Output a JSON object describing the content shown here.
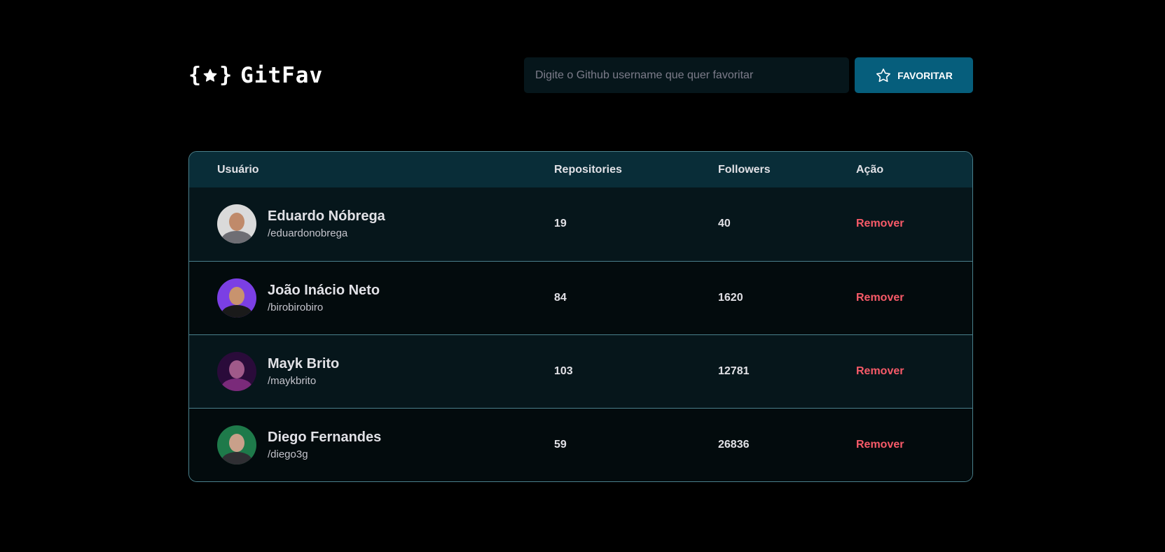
{
  "app": {
    "title": "GitFav",
    "logo_icon": "braces-star-icon"
  },
  "search": {
    "placeholder": "Digite o Github username que quer favoritar",
    "value": "",
    "button_label": "Favoritar",
    "button_icon": "star-outline-icon"
  },
  "colors": {
    "background": "#000000",
    "header_row": "#092D38",
    "row_odd": "#06161B",
    "row_even": "#030B0D",
    "border": "#4A808C",
    "button": "#065E7C",
    "remove": "#F75A68"
  },
  "table": {
    "headers": {
      "user": "Usuário",
      "repositories": "Repositories",
      "followers": "Followers",
      "action": "Ação"
    },
    "rows": [
      {
        "name": "Eduardo Nóbrega",
        "login": "/eduardonobrega",
        "repositories": "19",
        "followers": "40",
        "action": "Remover",
        "avatar_colors": [
          "#DADADA",
          "#C08A6A",
          "#6E6E74"
        ]
      },
      {
        "name": "João Inácio Neto",
        "login": "/birobirobiro",
        "repositories": "84",
        "followers": "1620",
        "action": "Remover",
        "avatar_colors": [
          "#7B3FE4",
          "#C8936E",
          "#1A1A1A"
        ]
      },
      {
        "name": "Mayk Brito",
        "login": "/maykbrito",
        "repositories": "103",
        "followers": "12781",
        "action": "Remover",
        "avatar_colors": [
          "#2A0B3A",
          "#A05A8A",
          "#7A2A7A"
        ]
      },
      {
        "name": "Diego Fernandes",
        "login": "/diego3g",
        "repositories": "59",
        "followers": "26836",
        "action": "Remover",
        "avatar_colors": [
          "#1E7A4A",
          "#C9A08A",
          "#2F2F33"
        ]
      }
    ]
  }
}
